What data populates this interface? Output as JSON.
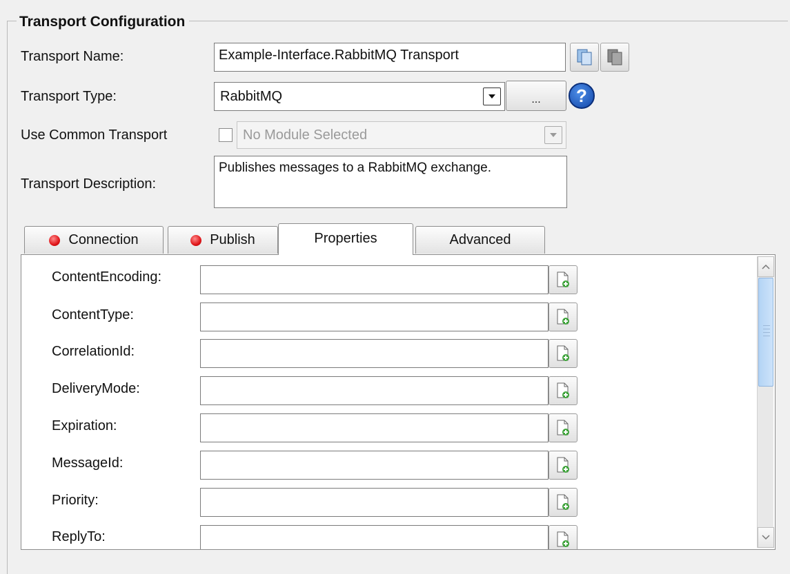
{
  "group": {
    "title": "Transport Configuration"
  },
  "labels": {
    "transport_name": "Transport Name:",
    "transport_type": "Transport Type:",
    "use_common_transport": "Use Common Transport",
    "transport_description": "Transport Description:"
  },
  "fields": {
    "transport_name_value": "Example-Interface.RabbitMQ Transport",
    "transport_type_value": "RabbitMQ",
    "common_module_value": "No Module Selected",
    "description_value": "Publishes messages to a RabbitMQ exchange.",
    "use_common_checked": false,
    "browse_label": "..."
  },
  "tabs": [
    {
      "label": "Connection",
      "has_error": true,
      "active": false
    },
    {
      "label": "Publish",
      "has_error": true,
      "active": false
    },
    {
      "label": "Properties",
      "has_error": false,
      "active": true
    },
    {
      "label": "Advanced",
      "has_error": false,
      "active": false
    }
  ],
  "properties": [
    {
      "label": "ContentEncoding:",
      "value": ""
    },
    {
      "label": "ContentType:",
      "value": ""
    },
    {
      "label": "CorrelationId:",
      "value": ""
    },
    {
      "label": "DeliveryMode:",
      "value": ""
    },
    {
      "label": "Expiration:",
      "value": ""
    },
    {
      "label": "MessageId:",
      "value": ""
    },
    {
      "label": "Priority:",
      "value": ""
    },
    {
      "label": "ReplyTo:",
      "value": ""
    }
  ],
  "icons": {
    "copy": "copy-icon",
    "copy_disabled": "copy-disabled-icon",
    "help": "help-icon",
    "add_property": "add-document-icon",
    "error": "error-dot-icon"
  },
  "colors": {
    "error_dot": "#e0161a",
    "help_blue": "#1246a8",
    "scroll_thumb": "#b3d4f5"
  }
}
